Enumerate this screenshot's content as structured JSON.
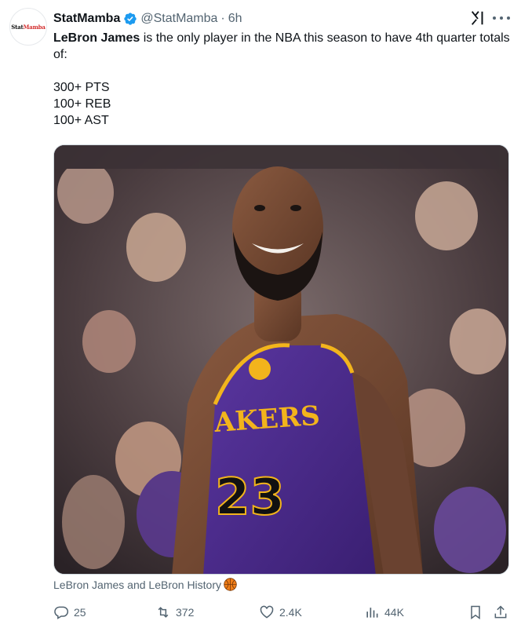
{
  "author": {
    "display_name": "StatMamba",
    "handle": "@StatMamba",
    "separator": "·",
    "time": "6h",
    "verified": true,
    "avatar_logo_a": "Stat",
    "avatar_logo_b": "Mamba"
  },
  "tweet": {
    "player_name": "LeBron James",
    "intro_rest": " is the only player in the NBA this season to have 4th quarter totals of:",
    "stat_lines": [
      "300+ PTS",
      "100+ REB",
      "100+ AST"
    ]
  },
  "media": {
    "caption": "LeBron James and LeBron History"
  },
  "actions": {
    "replies": "25",
    "reposts": "372",
    "likes": "2.4K",
    "views": "44K"
  },
  "icons": [
    "verified-icon",
    "grok-icon",
    "more-icon",
    "basketball-icon",
    "reply-icon",
    "repost-icon",
    "like-icon",
    "views-icon",
    "bookmark-icon",
    "share-icon"
  ],
  "colors": {
    "accent": "#1d9bf0",
    "secondary_text": "#536471",
    "primary_text": "#0f1419",
    "jersey_purple": "#4b2a8a",
    "jersey_gold": "#f2b41c"
  }
}
